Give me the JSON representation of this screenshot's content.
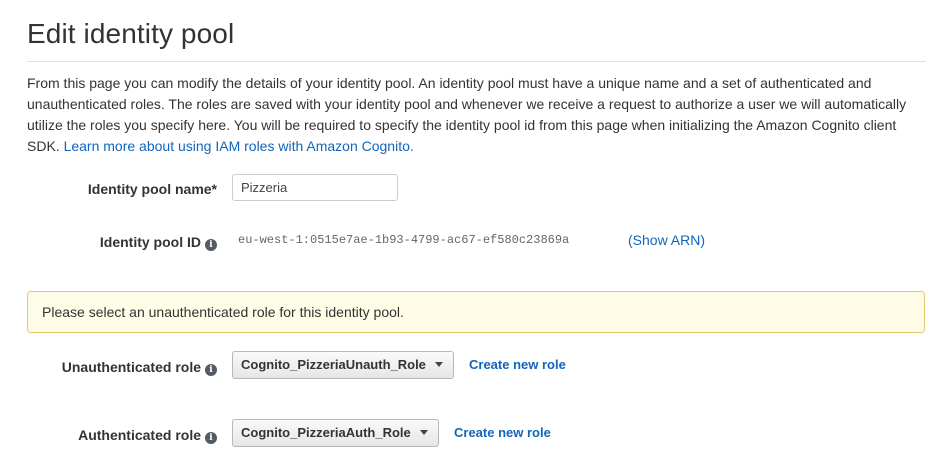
{
  "page": {
    "title": "Edit identity pool"
  },
  "intro": {
    "text": "From this page you can modify the details of your identity pool. An identity pool must have a unique name and a set of authenticated and unauthenticated roles. The roles are saved with your identity pool and whenever we receive a request to authorize a user we will automatically utilize the roles you specify here. You will be required to specify the identity pool id from this page when initializing the Amazon Cognito client SDK.",
    "link_text": "Learn more about using IAM roles with Amazon Cognito."
  },
  "form": {
    "pool_name_label": "Identity pool name*",
    "pool_name_value": "Pizzeria",
    "pool_id_label": "Identity pool ID",
    "pool_id_value": "eu-west-1:0515e7ae-1b93-4799-ac67-ef580c23869a",
    "show_arn_label": "(Show ARN)"
  },
  "alert": {
    "message": "Please select an unauthenticated role for this identity pool."
  },
  "roles": {
    "unauth_label": "Unauthenticated role",
    "unauth_selected": "Cognito_PizzeriaUnauth_Role",
    "auth_label": "Authenticated role",
    "auth_selected": "Cognito_PizzeriaAuth_Role",
    "create_new_label": "Create new role"
  },
  "icons": {
    "info": "info-icon",
    "dropdown": "caret-down-icon"
  },
  "colors": {
    "link": "#1166bb",
    "alert_bg": "#fffce7",
    "alert_border": "#e2c970"
  }
}
